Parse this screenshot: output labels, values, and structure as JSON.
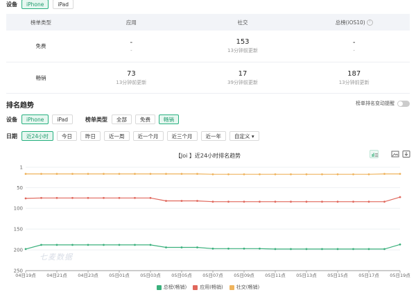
{
  "device_row": {
    "label": "设备",
    "options": [
      "iPhone",
      "iPad"
    ],
    "active": 0
  },
  "table": {
    "headers": [
      "榜单类型",
      "应用",
      "社交",
      "总榜(iOS10)"
    ],
    "rows": [
      {
        "type": "免费",
        "cells": [
          {
            "value": "-",
            "sub": "-"
          },
          {
            "value": "153",
            "sub": "13分钟前更新"
          },
          {
            "value": "-",
            "sub": "-"
          }
        ]
      },
      {
        "type": "畅销",
        "cells": [
          {
            "value": "73",
            "sub": "13分钟前更新"
          },
          {
            "value": "17",
            "sub": "39分钟前更新"
          },
          {
            "value": "187",
            "sub": "13分钟前更新"
          }
        ]
      }
    ]
  },
  "trend": {
    "title": "排名趋势",
    "toggle_label": "榜单排名变动提醒",
    "device_label": "设备",
    "device_options": [
      "iPhone",
      "iPad"
    ],
    "list_label": "榜单类型",
    "list_options": [
      "全部",
      "免费",
      "畅销"
    ],
    "date_label": "日期",
    "date_options": [
      "近24小时",
      "今日",
      "昨日",
      "近一周",
      "近一个月",
      "近三个月",
      "近一年",
      "自定义 ▾"
    ]
  },
  "chart_data": {
    "type": "line",
    "title": "【Joi 】近24小时排名趋势",
    "watermark": "七麦数据",
    "y_ticks": [
      1,
      50,
      100,
      150,
      200,
      250
    ],
    "ylim": [
      1,
      250
    ],
    "y_inverted": true,
    "x_tick_labels": [
      "04日19点",
      "04日21点",
      "04日23点",
      "05日01点",
      "05日03点",
      "05日05点",
      "05日07点",
      "05日09点",
      "05日11点",
      "05日13点",
      "05日15点",
      "05日17点",
      "05日19点"
    ],
    "x_count": 25,
    "legend_position": "bottom",
    "series": [
      {
        "name": "总榜(畅销)",
        "color": "#3ab07c",
        "values": [
          198,
          188,
          188,
          188,
          188,
          188,
          188,
          188,
          188,
          194,
          194,
          194,
          197,
          197,
          197,
          197,
          198,
          198,
          198,
          198,
          198,
          198,
          198,
          198,
          187
        ]
      },
      {
        "name": "应用(畅销)",
        "color": "#e0675c",
        "values": [
          76,
          75,
          75,
          75,
          75,
          75,
          75,
          75,
          75,
          82,
          82,
          82,
          84,
          84,
          84,
          84,
          84,
          84,
          84,
          84,
          84,
          84,
          84,
          84,
          73
        ]
      },
      {
        "name": "社交(畅销)",
        "color": "#efb45e",
        "values": [
          17,
          17,
          17,
          17,
          17,
          17,
          17,
          17,
          17,
          17,
          17,
          17,
          18,
          18,
          18,
          18,
          18,
          18,
          18,
          18,
          18,
          18,
          18,
          17,
          17
        ]
      }
    ]
  }
}
